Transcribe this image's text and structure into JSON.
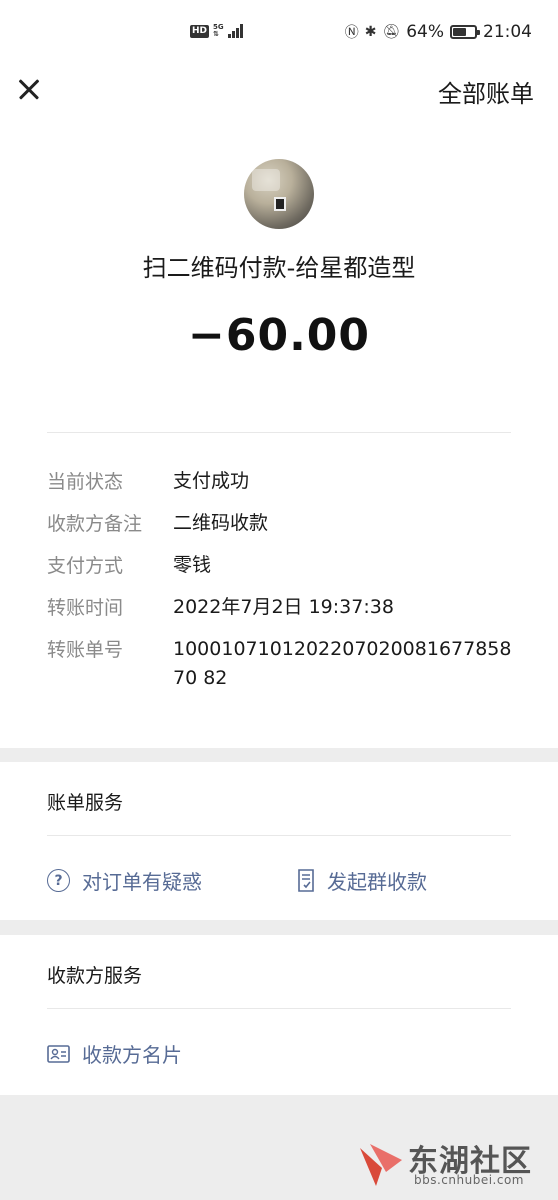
{
  "status_bar": {
    "network_badge": "HD",
    "network_type": "5G",
    "battery_percent": "64%",
    "battery_level": 0.64,
    "time": "21:04"
  },
  "header": {
    "all_bills_label": "全部账单"
  },
  "transaction": {
    "merchant": "扫二维码付款-给星都造型",
    "amount": "−60.00"
  },
  "details": [
    {
      "label": "当前状态",
      "value": "支付成功"
    },
    {
      "label": "收款方备注",
      "value": "二维码收款"
    },
    {
      "label": "支付方式",
      "value": "零钱"
    },
    {
      "label": "转账时间",
      "value": "2022年7月2日 19:37:38"
    },
    {
      "label": "转账单号",
      "value": "100010710120220702008167785870 82"
    }
  ],
  "bill_services": {
    "title": "账单服务",
    "items": [
      {
        "label": "对订单有疑惑",
        "icon": "question-circle-icon"
      },
      {
        "label": "发起群收款",
        "icon": "document-check-icon"
      }
    ]
  },
  "payee_services": {
    "title": "收款方服务",
    "items": [
      {
        "label": "收款方名片",
        "icon": "contact-card-icon"
      }
    ]
  },
  "watermark": {
    "name": "东湖社区",
    "url": "bbs.cnhubei.com"
  },
  "colors": {
    "link": "#576b95",
    "label_gray": "#8a8a8a",
    "background": "#ededed"
  }
}
